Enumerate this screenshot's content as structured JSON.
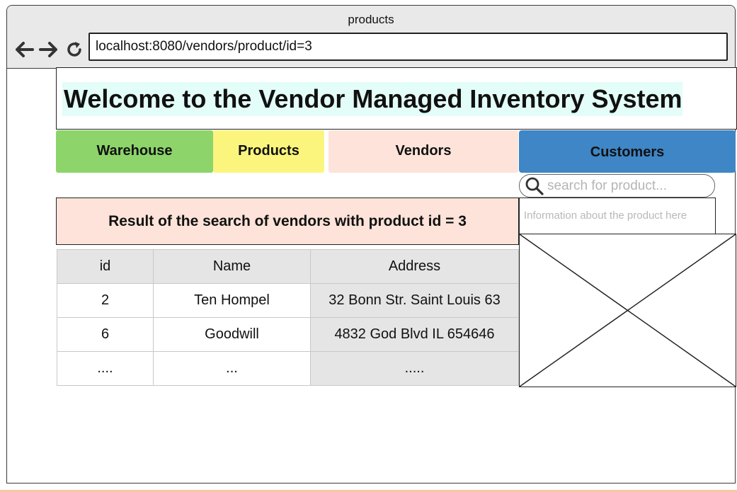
{
  "browser": {
    "window_title": "products",
    "url": "localhost:8080/vendors/product/id=3",
    "nav_icons": [
      "arrow-left-icon",
      "arrow-right-icon",
      "reload-icon"
    ]
  },
  "header": {
    "title": "Welcome to the Vendor Managed Inventory System"
  },
  "tabs": {
    "warehouse": "Warehouse",
    "products": "Products",
    "vendors": "Vendors",
    "customers": "Customers"
  },
  "search": {
    "placeholder": "search for product..."
  },
  "result": {
    "heading": "Result of the search of vendors with product id = 3"
  },
  "table": {
    "headers": [
      "id",
      "Name",
      "Address"
    ],
    "rows": [
      [
        "2",
        "Ten Hompel",
        "32 Bonn Str. Saint Louis 63"
      ],
      [
        "6",
        "Goodwill",
        "4832 God Blvd IL 654646"
      ],
      [
        "....",
        "...",
        "....."
      ]
    ]
  },
  "product_panel": {
    "info_text": "Information about the product here"
  },
  "colors": {
    "warehouse_tab": "#8dd46a",
    "products_tab": "#fbf57d",
    "vendors_tab": "#fde3d9",
    "customers_tab": "#3e86c6",
    "title_highlight": "#e3fdf8"
  }
}
